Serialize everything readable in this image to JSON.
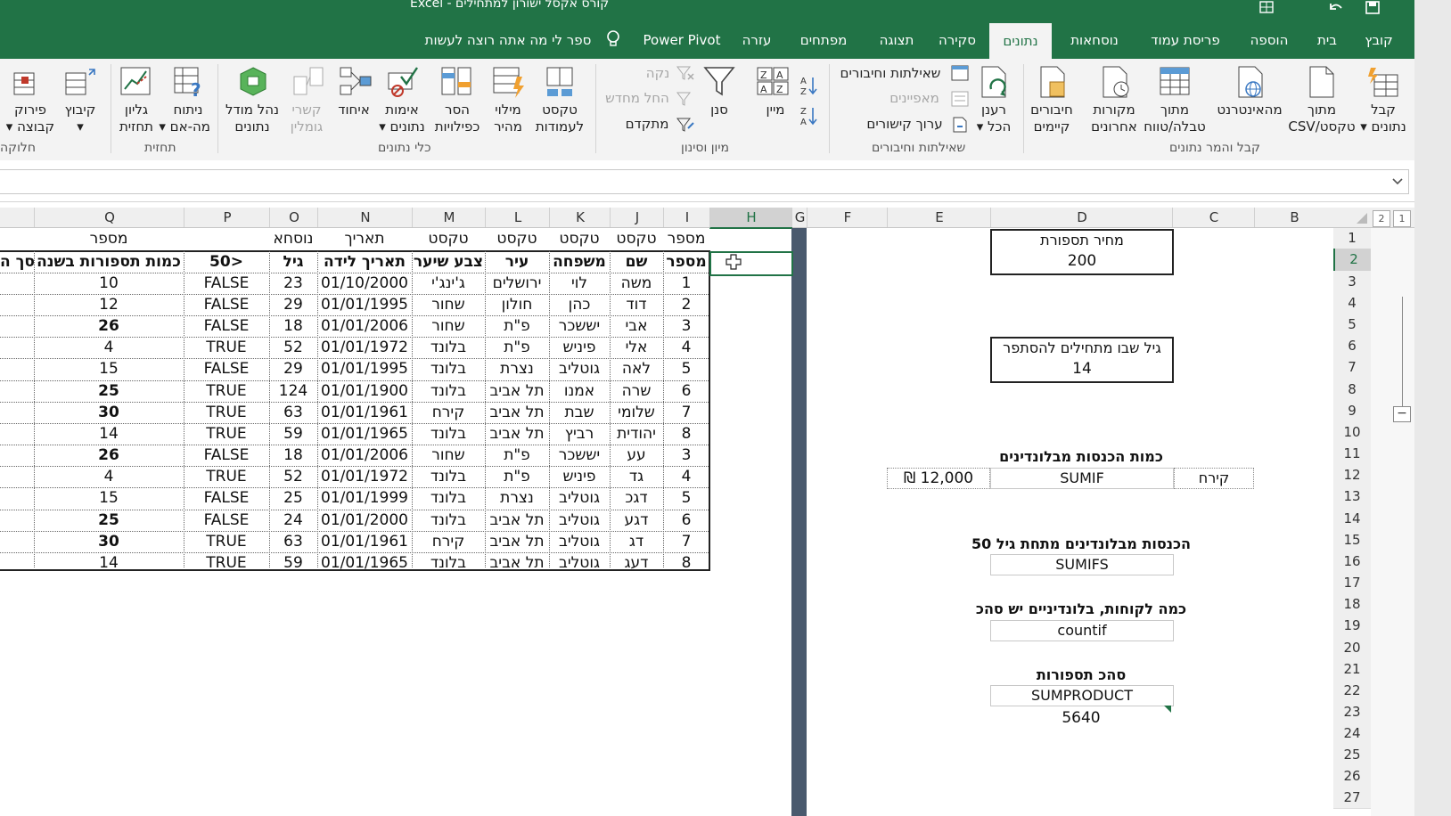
{
  "app": {
    "title": "Excel  -  קורס אקסל ישורון למתחילים"
  },
  "tabs": [
    {
      "label": "קובץ"
    },
    {
      "label": "בית"
    },
    {
      "label": "הוספה"
    },
    {
      "label": "פריסת עמוד"
    },
    {
      "label": "נוסחאות"
    },
    {
      "label": "נתונים"
    },
    {
      "label": "סקירה"
    },
    {
      "label": "תצוגה"
    },
    {
      "label": "מפתחים"
    },
    {
      "label": "עזרה"
    },
    {
      "label": "Power Pivot"
    },
    {
      "label": "ספר לי מה אתה רוצה לעשות"
    }
  ],
  "ribbon": {
    "groups": {
      "get_data": "קבל והמר נתונים",
      "queries": "שאילתות וחיבורים",
      "sort_filter": "מיון וסינון",
      "data_tools": "כלי נתונים",
      "forecast": "תחזית",
      "outline": "חלוקה"
    },
    "buttons": {
      "get_data": [
        "קבל",
        "נתונים ▾"
      ],
      "from_csv": [
        "מתוך",
        "טקסט/CSV"
      ],
      "from_web": [
        "מהאינטרנט",
        ""
      ],
      "from_table": [
        "מתוך",
        "טבלה/טווח"
      ],
      "recent_sources": [
        "מקורות",
        "אחרונים"
      ],
      "existing_conn": [
        "חיבורים",
        "קיימים"
      ],
      "refresh_all": [
        "רענן",
        "הכל ▾"
      ],
      "queries_conn": "שאילתות וחיבורים",
      "properties": "מאפיינים",
      "edit_links": "ערוך קישורים",
      "sort": "מיין",
      "filter": "סנן",
      "clear": "נקה",
      "reapply": "החל מחדש",
      "advanced": "מתקדם",
      "text_to_cols": [
        "טקסט",
        "לעמודות"
      ],
      "flash_fill": [
        "מילוי",
        "מהיר"
      ],
      "remove_dup": [
        "הסר",
        "כפילויות"
      ],
      "validation": [
        "אימות",
        "נתונים ▾"
      ],
      "consolidate": [
        "איחוד",
        ""
      ],
      "relationships": [
        "קשרי",
        "גומלין"
      ],
      "data_model": [
        "נהל מודל",
        "נתונים"
      ],
      "whatif": [
        "ניתוח",
        "מה-אם ▾"
      ],
      "forecast_sheet": [
        "גליון",
        "תחזית"
      ],
      "group": [
        "קיבוץ",
        "▾"
      ],
      "ungroup": [
        "פירוק",
        "קבוצה ▾"
      ]
    }
  },
  "grid": {
    "columns": [
      "Q",
      "P",
      "O",
      "N",
      "M",
      "L",
      "K",
      "J",
      "I",
      "H",
      "G",
      "F",
      "E",
      "D",
      "C",
      "B"
    ],
    "selected_column": "H",
    "rows": [
      "1",
      "2",
      "3",
      "4",
      "5",
      "6",
      "7",
      "8",
      "9",
      "10",
      "11",
      "12",
      "13",
      "14",
      "15",
      "16",
      "17",
      "18",
      "19",
      "20",
      "21",
      "22",
      "23",
      "24",
      "25",
      "26",
      "27"
    ],
    "selected_row": "2",
    "outline_levels": [
      "1",
      "2"
    ]
  },
  "table": {
    "type_row": {
      "Q": "מספר",
      "P": "",
      "O": "נוסחא",
      "N": "תאריך",
      "M": "טקסט",
      "L": "טקסט",
      "K": "טקסט",
      "J": "טקסט",
      "I": "מספר"
    },
    "headers": {
      "R": "סך ה",
      "Q": "כמות תספורות בשנה",
      "P": "50>",
      "O": "גיל",
      "N": "תאריך לידה",
      "M": "צבע שיער",
      "L": "עיר",
      "K": "משפחה",
      "J": "שם",
      "I": "מספר"
    },
    "rows": [
      {
        "Q": "10",
        "qb": false,
        "P": "FALSE",
        "O": "23",
        "N": "01/10/2000",
        "M": "ג'ינג'י",
        "L": "ירושלים",
        "K": "לוי",
        "J": "משה",
        "I": "1"
      },
      {
        "Q": "12",
        "qb": false,
        "P": "FALSE",
        "O": "29",
        "N": "01/01/1995",
        "M": "שחור",
        "L": "חולון",
        "K": "כהן",
        "J": "דוד",
        "I": "2"
      },
      {
        "Q": "26",
        "qb": true,
        "P": "FALSE",
        "O": "18",
        "N": "01/01/2006",
        "M": "שחור",
        "L": "פ\"ת",
        "K": "יששכר",
        "J": "אבי",
        "I": "3"
      },
      {
        "Q": "4",
        "qb": false,
        "P": "TRUE",
        "O": "52",
        "N": "01/01/1972",
        "M": "בלונד",
        "L": "פ\"ת",
        "K": "פיניש",
        "J": "אלי",
        "I": "4"
      },
      {
        "Q": "15",
        "qb": false,
        "P": "FALSE",
        "O": "29",
        "N": "01/01/1995",
        "M": "בלונד",
        "L": "נצרת",
        "K": "גוטליב",
        "J": "לאה",
        "I": "5"
      },
      {
        "Q": "25",
        "qb": true,
        "P": "TRUE",
        "O": "124",
        "N": "01/01/1900",
        "M": "בלונד",
        "L": "תל אביב",
        "K": "אמנו",
        "J": "שרה",
        "I": "6"
      },
      {
        "Q": "30",
        "qb": true,
        "P": "TRUE",
        "O": "63",
        "N": "01/01/1961",
        "M": "קירח",
        "L": "תל אביב",
        "K": "שבת",
        "J": "שלומי",
        "I": "7"
      },
      {
        "Q": "14",
        "qb": false,
        "P": "TRUE",
        "O": "59",
        "N": "01/01/1965",
        "M": "בלונד",
        "L": "תל אביב",
        "K": "רביץ",
        "J": "יהודית",
        "I": "8"
      },
      {
        "Q": "26",
        "qb": true,
        "P": "FALSE",
        "O": "18",
        "N": "01/01/2006",
        "M": "שחור",
        "L": "פ\"ת",
        "K": "יששכר",
        "J": "עע",
        "I": "3"
      },
      {
        "Q": "4",
        "qb": false,
        "P": "TRUE",
        "O": "52",
        "N": "01/01/1972",
        "M": "בלונד",
        "L": "פ\"ת",
        "K": "פיניש",
        "J": "גד",
        "I": "4"
      },
      {
        "Q": "15",
        "qb": false,
        "P": "FALSE",
        "O": "25",
        "N": "01/01/1999",
        "M": "בלונד",
        "L": "נצרת",
        "K": "גוטליב",
        "J": "דגכ",
        "I": "5"
      },
      {
        "Q": "25",
        "qb": true,
        "P": "FALSE",
        "O": "24",
        "N": "01/01/2000",
        "M": "בלונד",
        "L": "תל אביב",
        "K": "גוטליב",
        "J": "דגע",
        "I": "6"
      },
      {
        "Q": "30",
        "qb": true,
        "P": "TRUE",
        "O": "63",
        "N": "01/01/1961",
        "M": "קירח",
        "L": "תל אביב",
        "K": "גוטליב",
        "J": "דג",
        "I": "7"
      },
      {
        "Q": "14",
        "qb": false,
        "P": "TRUE",
        "O": "59",
        "N": "01/01/1965",
        "M": "בלונד",
        "L": "תל אביב",
        "K": "גוטליב",
        "J": "דעג",
        "I": "8"
      }
    ]
  },
  "panels": {
    "price": {
      "label": "מחיר תספורת",
      "value": "200"
    },
    "start_age": {
      "label": "גיל שבו מתחילים להסתפר",
      "value": "14"
    },
    "sumif": {
      "title": "כמות הכנסות מבלונדינים",
      "criteria": "קירח",
      "func": "SUMIF",
      "result": "₪ 12,000"
    },
    "sumifs": {
      "title": "הכנסות מבלונדינים מתחת גיל 50",
      "func": "SUMIFS"
    },
    "countif": {
      "title": "כמה לקוחות, בלונדיניים יש סהכ",
      "func": "countif"
    },
    "sumproduct": {
      "title": "סהכ תספורות",
      "func": "SUMPRODUCT",
      "result": "5640"
    }
  },
  "colors": {
    "excel_green": "#217346",
    "freeze_pane": "#4a5a6e",
    "selection": "#217346"
  }
}
